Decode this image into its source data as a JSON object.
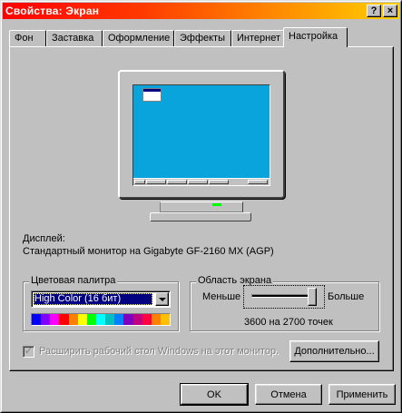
{
  "window": {
    "title": "Свойства: Экран",
    "help_button": "?",
    "close_button": "×",
    "titlebar_colors": [
      "#ff0000",
      "#ffd000"
    ]
  },
  "tabs": [
    {
      "label": "Фон",
      "active": false
    },
    {
      "label": "Заставка",
      "active": false
    },
    {
      "label": "Оформление",
      "active": false
    },
    {
      "label": "Эффекты",
      "active": false
    },
    {
      "label": "Интернет",
      "active": false
    },
    {
      "label": "Настройка",
      "active": true
    }
  ],
  "preview": {
    "screen_color": "#0aa4dc",
    "led_color": "#00ff00"
  },
  "display": {
    "label": "Дисплей:",
    "value": "Стандартный монитор на Gigabyte GF-2160 MX (AGP)"
  },
  "color_palette": {
    "title": "Цветовая палитра",
    "selected": "High Color (16 бит)",
    "swatches": [
      "#0000ff",
      "#8000ff",
      "#ff00ff",
      "#ff0000",
      "#ff8000",
      "#ffff00",
      "#00ff00",
      "#00ffff",
      "#00c0c0",
      "#0080ff",
      "#8000c0",
      "#c00080",
      "#ff0040",
      "#ff8000",
      "#ffc000"
    ]
  },
  "screen_area": {
    "title": "Область экрана",
    "less_label": "Меньше",
    "more_label": "Больше",
    "resolution": "3600 на 2700 точек",
    "slider_fraction": 1.0
  },
  "extend_desktop": {
    "label": "Расширить рабочий стол Windows на этот монитор.",
    "checked": true,
    "enabled": false
  },
  "buttons": {
    "advanced": "Дополнительно...",
    "ok": "OK",
    "cancel": "Отмена",
    "apply": "Применить"
  }
}
